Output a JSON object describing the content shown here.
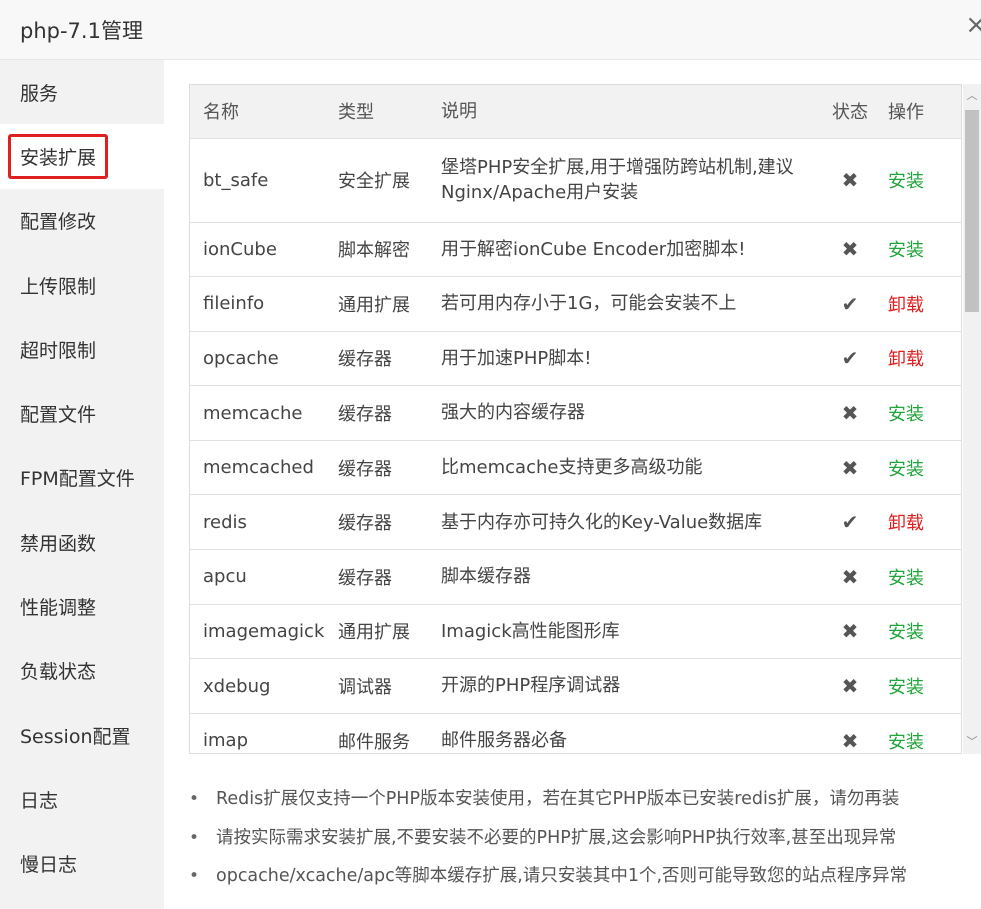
{
  "window": {
    "title": "php-7.1管理",
    "close_glyph": "×"
  },
  "sidebar": {
    "items": [
      {
        "label": "服务"
      },
      {
        "label": "安装扩展"
      },
      {
        "label": "配置修改"
      },
      {
        "label": "上传限制"
      },
      {
        "label": "超时限制"
      },
      {
        "label": "配置文件"
      },
      {
        "label": "FPM配置文件"
      },
      {
        "label": "禁用函数"
      },
      {
        "label": "性能调整"
      },
      {
        "label": "负载状态"
      },
      {
        "label": "Session配置"
      },
      {
        "label": "日志"
      },
      {
        "label": "慢日志"
      }
    ]
  },
  "table": {
    "headers": {
      "name": "名称",
      "type": "类型",
      "desc": "说明",
      "status": "状态",
      "op": "操作"
    },
    "rows": [
      {
        "name": "bt_safe",
        "type": "安全扩展",
        "desc": "堡塔PHP安全扩展,用于增强防跨站机制,建议Nginx/Apache用户安装",
        "status": "✖",
        "action": "安装"
      },
      {
        "name": "ionCube",
        "type": "脚本解密",
        "desc": "用于解密ionCube Encoder加密脚本!",
        "status": "✖",
        "action": "安装"
      },
      {
        "name": "fileinfo",
        "type": "通用扩展",
        "desc": "若可用内存小于1G，可能会安装不上",
        "status": "✔",
        "action": "卸载"
      },
      {
        "name": "opcache",
        "type": "缓存器",
        "desc": "用于加速PHP脚本!",
        "status": "✔",
        "action": "卸载"
      },
      {
        "name": "memcache",
        "type": "缓存器",
        "desc": "强大的内容缓存器",
        "status": "✖",
        "action": "安装"
      },
      {
        "name": "memcached",
        "type": "缓存器",
        "desc": "比memcache支持更多高级功能",
        "status": "✖",
        "action": "安装"
      },
      {
        "name": "redis",
        "type": "缓存器",
        "desc": "基于内存亦可持久化的Key-Value数据库",
        "status": "✔",
        "action": "卸载"
      },
      {
        "name": "apcu",
        "type": "缓存器",
        "desc": "脚本缓存器",
        "status": "✖",
        "action": "安装"
      },
      {
        "name": "imagemagick",
        "type": "通用扩展",
        "desc": "Imagick高性能图形库",
        "status": "✖",
        "action": "安装"
      },
      {
        "name": "xdebug",
        "type": "调试器",
        "desc": "开源的PHP程序调试器",
        "status": "✖",
        "action": "安装"
      },
      {
        "name": "imap",
        "type": "邮件服务",
        "desc": "邮件服务器必备",
        "status": "✖",
        "action": "安装"
      }
    ]
  },
  "scrollbar": {
    "up_glyph": "︿",
    "down_glyph": "﹀"
  },
  "notes": [
    {
      "bullet": "•",
      "text": "Redis扩展仅支持一个PHP版本安装使用，若在其它PHP版本已安装redis扩展，请勿再装"
    },
    {
      "bullet": "•",
      "text": "请按实际需求安装扩展,不要安装不必要的PHP扩展,这会影响PHP执行效率,甚至出现异常"
    },
    {
      "bullet": "•",
      "text": "opcache/xcache/apc等脚本缓存扩展,请只安装其中1个,否则可能导致您的站点程序异常"
    }
  ]
}
